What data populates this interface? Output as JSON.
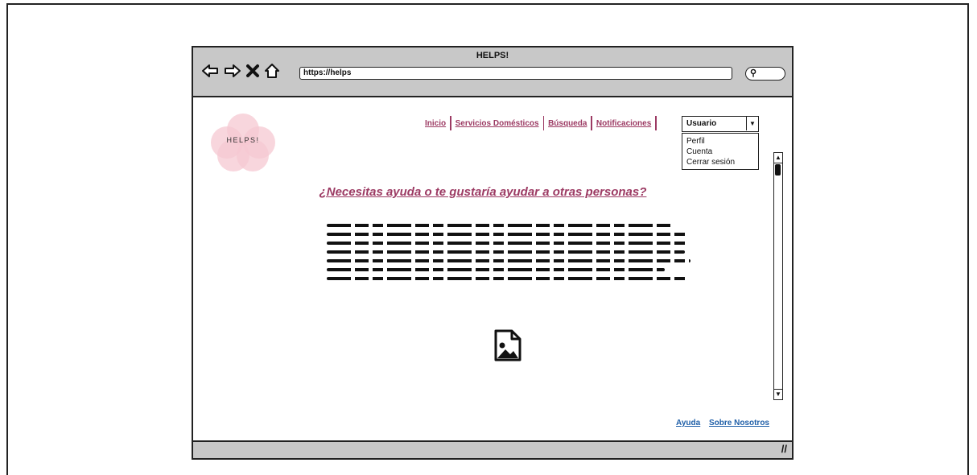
{
  "window": {
    "title": "HELPS!"
  },
  "toolbar": {
    "back_icon": "arrow-left-icon",
    "forward_icon": "arrow-right-icon",
    "close_icon": "x-icon",
    "home_icon": "home-icon",
    "url": "https://helps",
    "search_icon": "search-icon"
  },
  "logo": {
    "text": "HELPS!"
  },
  "nav": {
    "items": [
      "Inicio",
      "Servicios Domésticos",
      "Búsqueda",
      "Notificaciones"
    ]
  },
  "user_menu": {
    "selected": "Usuario",
    "options": [
      "Perfil",
      "Cuenta",
      "Cerrar sesión"
    ]
  },
  "main": {
    "headline": "¿Necesitas ayuda o te gustaría ayudar a otras personas?",
    "image_icon": "image-file-icon"
  },
  "footer": {
    "links": [
      "Ayuda",
      "Sobre Nosotros"
    ]
  },
  "colors": {
    "accent": "#9c3a63",
    "link": "#1f5fa8",
    "logo": "#f6c8d2",
    "chrome": "#c8c8c8"
  }
}
